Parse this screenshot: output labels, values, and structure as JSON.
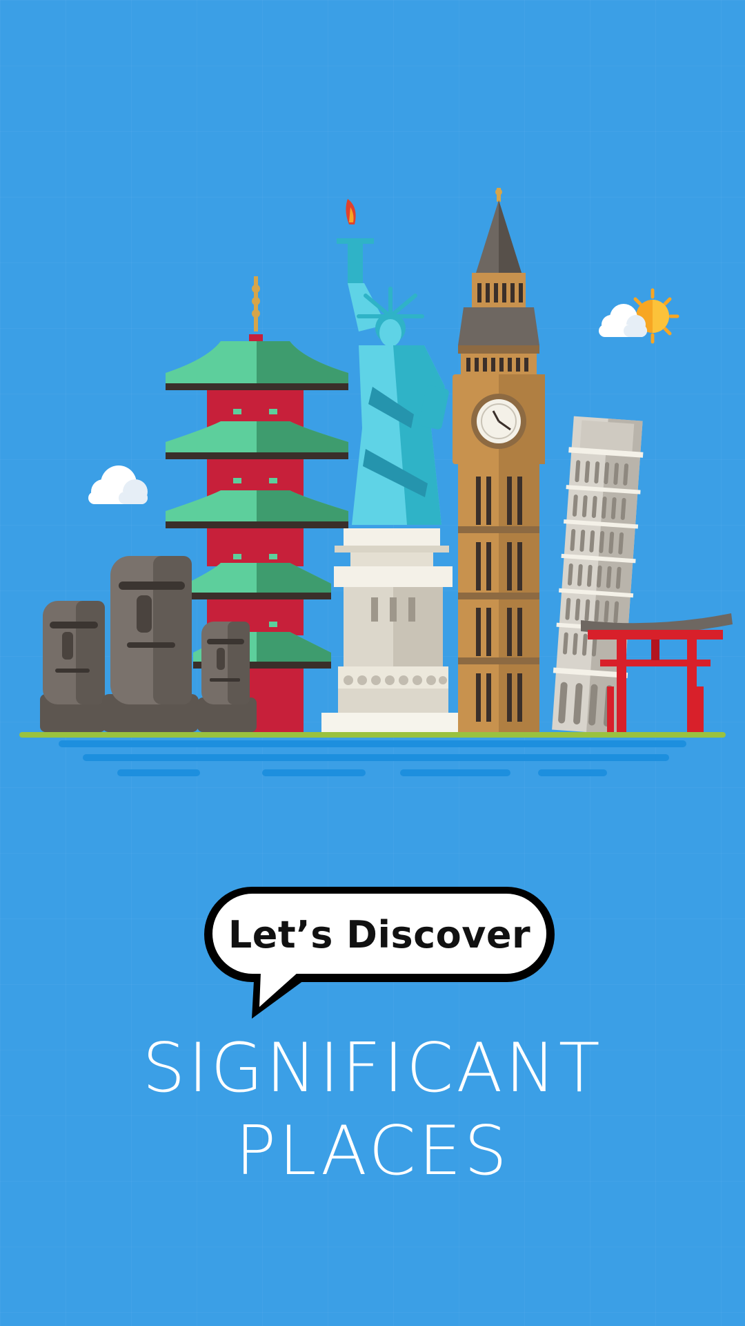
{
  "illustration": {
    "landmarks": [
      "moai-statues",
      "pagoda",
      "statue-of-liberty",
      "big-ben",
      "leaning-tower-of-pisa",
      "torii-gate"
    ],
    "weather": [
      "sun-icon",
      "cloud-icon"
    ]
  },
  "speech_bubble": {
    "text": "Let’s Discover"
  },
  "headline": {
    "line1": "SIGNIFICANT",
    "line2": "PLACES"
  },
  "colors": {
    "background": "#3b9fe6",
    "pagoda_roof": "#5dcf9c",
    "pagoda_body": "#c7203a",
    "liberty": "#5fd3e6",
    "big_ben": "#c8924e",
    "torii": "#d8202a",
    "moai": "#6d6560",
    "water": "#1d8fde"
  }
}
